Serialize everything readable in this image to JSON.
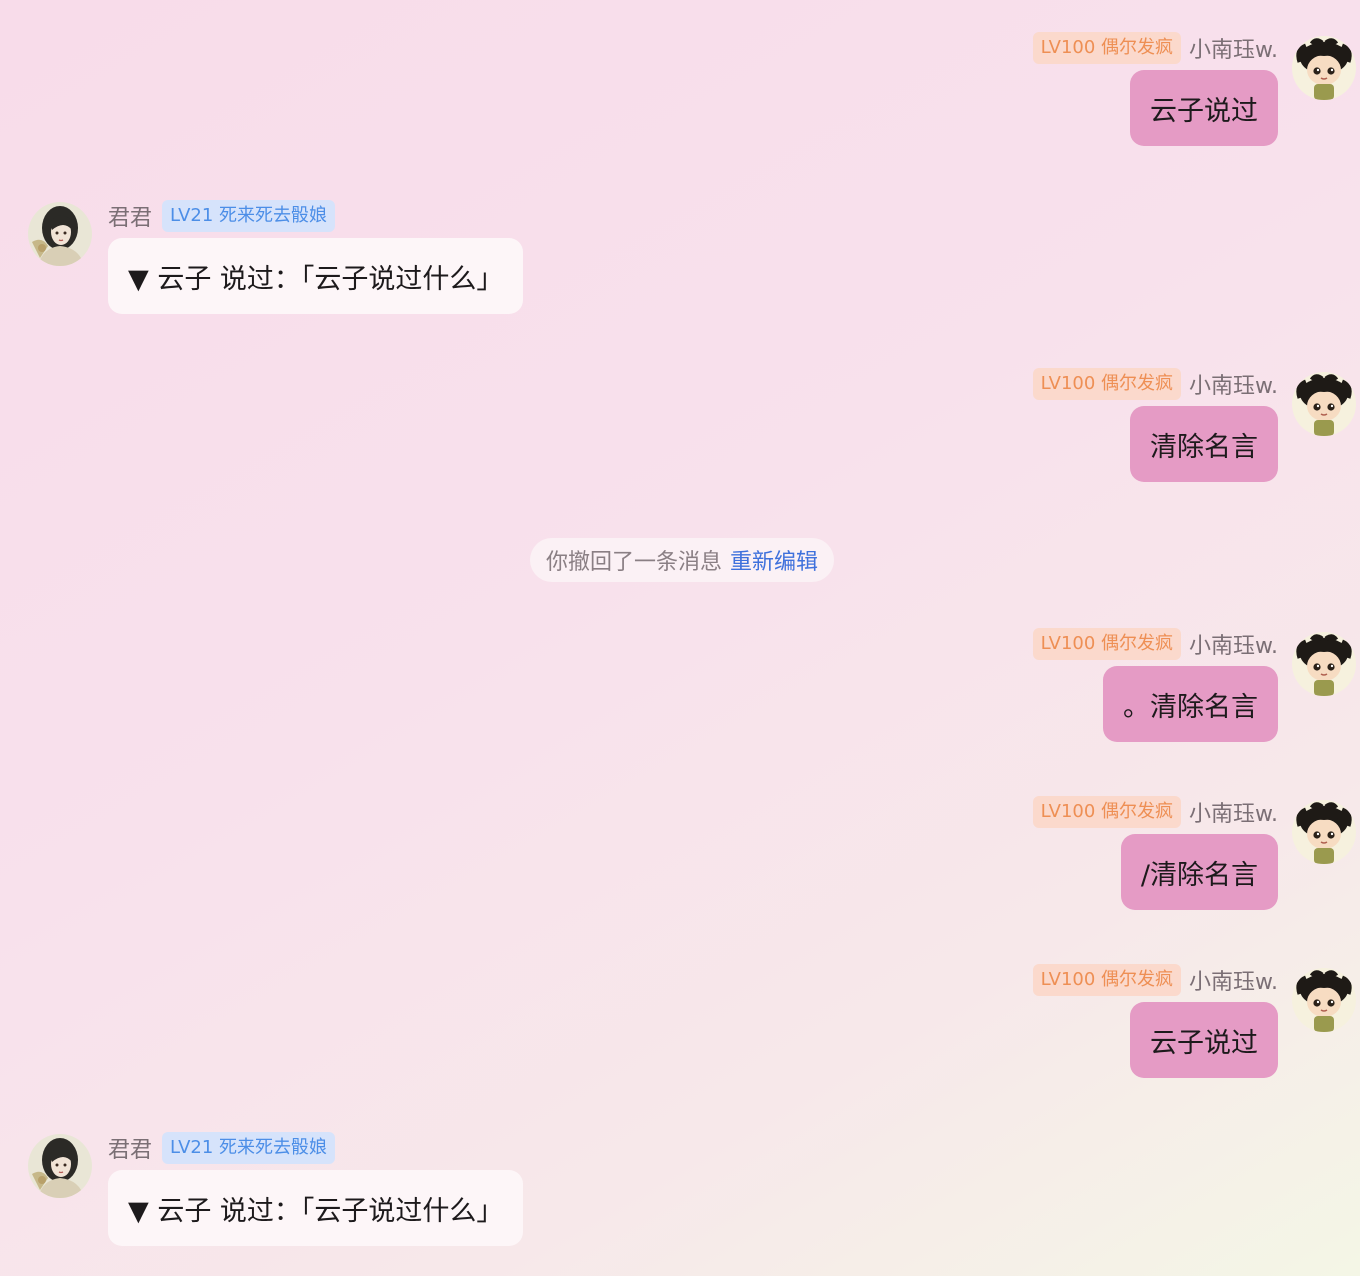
{
  "chat": {
    "messages": [
      {
        "direction": "out",
        "name": "小南珏w.",
        "badge": "LV100 偶尔发疯",
        "text": "云子说过"
      },
      {
        "direction": "in",
        "name": "君君",
        "badge": "LV21 死来死去骰娘",
        "text": "▼ 云子 说过：「云子说过什么」"
      },
      {
        "direction": "out",
        "name": "小南珏w.",
        "badge": "LV100 偶尔发疯",
        "text": "清除名言"
      },
      {
        "direction": "out",
        "name": "小南珏w.",
        "badge": "LV100 偶尔发疯",
        "text": "。清除名言"
      },
      {
        "direction": "out",
        "name": "小南珏w.",
        "badge": "LV100 偶尔发疯",
        "text": "/清除名言"
      },
      {
        "direction": "out",
        "name": "小南珏w.",
        "badge": "LV100 偶尔发疯",
        "text": "云子说过"
      },
      {
        "direction": "in",
        "name": "君君",
        "badge": "LV21 死来死去骰娘",
        "text": "▼ 云子 说过：「云子说过什么」"
      }
    ],
    "recall_notice": {
      "text": "你撤回了一条消息",
      "action": "重新编辑"
    }
  },
  "icons": {
    "outgoing_avatar": "chibi-avatar-icon",
    "incoming_avatar": "portrait-avatar-icon"
  },
  "colors": {
    "outgoing_bubble": "#e59bc5",
    "incoming_bubble": "#fdf6f8",
    "badge_orange_bg": "#fbd9cc",
    "badge_orange_text": "#ee8f54",
    "badge_blue_bg": "#d6e3fb",
    "badge_blue_text": "#4c8ee7",
    "link": "#3f71dc"
  }
}
